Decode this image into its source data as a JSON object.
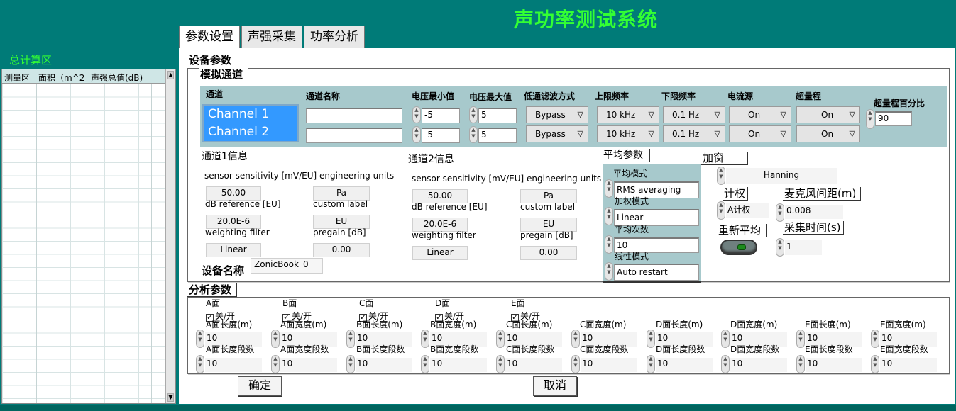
{
  "title": "声功率测试系统",
  "left_panel": {
    "title": "总计算区",
    "columns": [
      "测量区",
      "面积（m^2",
      "声强总值(dB)"
    ]
  },
  "tabs": [
    "参数设置",
    "声强采集",
    "功率分析"
  ],
  "device": {
    "section_label": "设备参数",
    "analog_label": "模拟通道",
    "headers": {
      "channel": "通道",
      "name": "通道名称",
      "vmin": "电压最小值",
      "vmax": "电压最大值",
      "lpf": "低通滤波方式",
      "upper": "上限频率",
      "lower": "下限频率",
      "current": "电流源",
      "overrange": "超量程",
      "overrange_pct": "超量程百分比"
    },
    "channels": [
      {
        "label": "Channel 1",
        "name": "",
        "vmin": "-5",
        "vmax": "5",
        "lpf": "Bypass",
        "upper": "10 kHz",
        "lower": "0.1 Hz",
        "current": "On",
        "overrange": "On"
      },
      {
        "label": "Channel 2",
        "name": "",
        "vmin": "-5",
        "vmax": "5",
        "lpf": "Bypass",
        "upper": "10 kHz",
        "lower": "0.1 Hz",
        "current": "On",
        "overrange": "On"
      }
    ],
    "overrange_pct_value": "90",
    "ch1_info": {
      "title": "通道1信息",
      "header": "sensor sensitivity [mV/EU] engineering units",
      "sensitivity": "50.00",
      "eu": "Pa",
      "dbref_label": "dB reference [EU]",
      "custom_label": "custom label",
      "dbref": "20.0E-6",
      "custom": "EU",
      "wf_label": "weighting filter",
      "pregain_label": "pregain [dB]",
      "wf": "Linear",
      "pregain": "0.00"
    },
    "ch2_info": {
      "title": "通道2信息",
      "header": "sensor sensitivity [mV/EU] engineering units",
      "sensitivity": "50.00",
      "eu": "Pa",
      "dbref_label": "dB reference [EU]",
      "custom_label": "custom label",
      "dbref": "20.0E-6",
      "custom": "EU",
      "wf_label": "weighting filter",
      "pregain_label": "pregain [dB]",
      "wf": "Linear",
      "pregain": "0.00"
    },
    "device_name_label": "设备名称",
    "device_name": "ZonicBook_0",
    "avg": {
      "title": "平均参数",
      "mode_label": "平均模式",
      "mode": "RMS averaging",
      "weight_label": "加权模式",
      "weight": "Linear",
      "count_label": "平均次数",
      "count": "10",
      "linear_label": "线性模式",
      "linear": "Auto restart"
    },
    "window": {
      "title": "加窗",
      "value": "Hanning"
    },
    "weighting": {
      "title": "计权",
      "value": "A计权"
    },
    "mic": {
      "title": "麦克风间距(m)",
      "value": "0.008"
    },
    "reaverage": "重新平均",
    "acq": {
      "title": "采集时间(s)",
      "value": "1"
    }
  },
  "analysis": {
    "section_label": "分析参数",
    "faces": [
      {
        "face": "A面",
        "toggle": "关/开"
      },
      {
        "face": "B面",
        "toggle": "关/开"
      },
      {
        "face": "C面",
        "toggle": "关/开"
      },
      {
        "face": "D面",
        "toggle": "关/开"
      },
      {
        "face": "E面",
        "toggle": "关/开"
      }
    ],
    "params": [
      {
        "top": "A面长度(m)",
        "topval": "10",
        "bot": "A面长度段数",
        "botval": "10"
      },
      {
        "top": "A面宽度(m)",
        "topval": "10",
        "bot": "A面宽度段数",
        "botval": "10"
      },
      {
        "top": "B面长度(m)",
        "topval": "10",
        "bot": "B面长度段数",
        "botval": "10"
      },
      {
        "top": "B面宽度(m)",
        "topval": "10",
        "bot": "B面宽度段数",
        "botval": "10"
      },
      {
        "top": "C面长度(m)",
        "topval": "10",
        "bot": "C面长度段数",
        "botval": "10"
      },
      {
        "top": "C面宽度(m)",
        "topval": "10",
        "bot": "C面宽度段数",
        "botval": "10"
      },
      {
        "top": "D面长度(m)",
        "topval": "10",
        "bot": "D面长度段数",
        "botval": "10"
      },
      {
        "top": "D面宽度(m)",
        "topval": "10",
        "bot": "D面宽度段数",
        "botval": "10"
      },
      {
        "top": "E面长度(m)",
        "topval": "10",
        "bot": "E面长度段数",
        "botval": "10"
      },
      {
        "top": "E面宽度(m)",
        "topval": "10",
        "bot": "E面宽度段数",
        "botval": "10"
      }
    ]
  },
  "buttons": {
    "ok": "确定",
    "cancel": "取消"
  }
}
